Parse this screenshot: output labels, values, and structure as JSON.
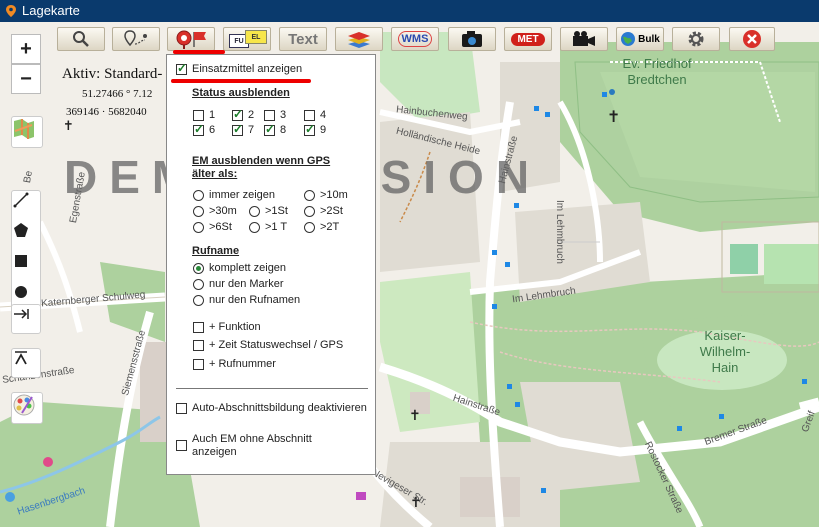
{
  "window": {
    "title": "Lagekarte"
  },
  "toolbar": {
    "text_button": "Text",
    "wms_button": "WMS",
    "met_button": "MET",
    "bulk_button": "Bulk",
    "fu_label": "FU",
    "el_label": "EL"
  },
  "map": {
    "zoom_in": "+",
    "zoom_out": "−",
    "watermark": "DEMOVERSION",
    "info": {
      "title": "Aktiv: Standard-",
      "coord1": "51.27466 ° 7.12",
      "coord2": "369146 · 5682040"
    },
    "labels": {
      "hainbuchenweg": "Hainbuchenweg",
      "hollaendische_heide": "Holländische Heide",
      "hainstrasse_top": "Hainstraße",
      "im_lehmbruch_v": "Im Lehmbruch",
      "im_lehmbruch_h": "Im Lehmbruch",
      "katernberger": "Katernberger Schulweg",
      "siemensstrasse": "Siemensstraße",
      "schanzenstrasse": "Schanzenstraße",
      "hainstrasse_bottom": "Hainstraße",
      "bremer_strasse": "Bremer Straße",
      "rostocker_strasse": "Rostocker Straße",
      "nevigeser": "Nevigeser Str.",
      "hasenbergbach": "Hasenbergbach",
      "eigenstrasse": "Egenstraße",
      "greif": "Greif",
      "be": "Be",
      "friedhof": "Ev. Friedhof Bredtchen",
      "kaiser_wilhelm_hain": "Kaiser-Wilhelm-Hain"
    }
  },
  "panel": {
    "show_units": {
      "label": "Einsatzmittel anzeigen",
      "checked": true
    },
    "status_header": "Status ausblenden",
    "status": [
      {
        "num": "1",
        "checked": false
      },
      {
        "num": "2",
        "checked": true
      },
      {
        "num": "3",
        "checked": false
      },
      {
        "num": "4",
        "checked": false
      },
      {
        "num": "6",
        "checked": true
      },
      {
        "num": "7",
        "checked": true
      },
      {
        "num": "8",
        "checked": true
      },
      {
        "num": "9",
        "checked": true
      }
    ],
    "gps_header_line1": "EM ausblenden wenn GPS",
    "gps_header_line2": "älter als:",
    "gps_options": [
      "immer zeigen",
      ">10m",
      ">30m",
      ">1St",
      ">2St",
      ">6St",
      ">1 T",
      ">2T"
    ],
    "rufname_header": "Rufname",
    "rufname_options": [
      "komplett zeigen",
      "nur den Marker",
      "nur den Rufnamen"
    ],
    "rufname_selected": "komplett zeigen",
    "extras": [
      "+ Funktion",
      "+ Zeit Statuswechsel / GPS",
      "+ Rufnummer"
    ],
    "auto_section": "Auto-Abschnittsbildung deaktivieren",
    "em_without_section_line1": "Auch EM ohne Abschnitt",
    "em_without_section_line2": "anzeigen"
  },
  "colors": {
    "title_bar": "#0a3a6d",
    "highlight": "#e00000",
    "check_green": "#1c7d2a",
    "park_green": "#c8e7c0",
    "forest_green": "#add19e"
  }
}
